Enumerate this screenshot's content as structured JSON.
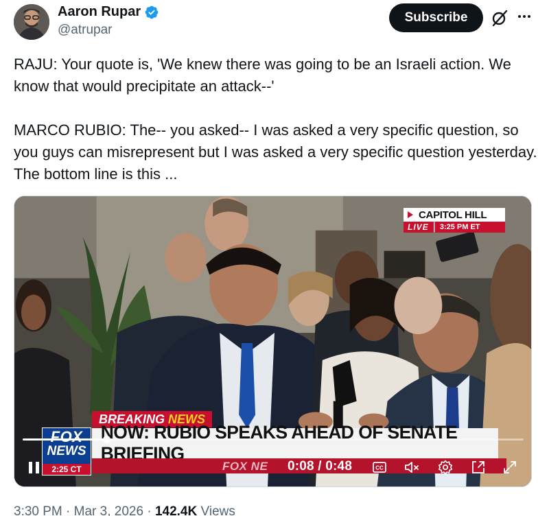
{
  "author": {
    "display_name": "Aaron Rupar",
    "handle": "@atrupar",
    "verified": true
  },
  "actions": {
    "subscribe_label": "Subscribe",
    "grok_icon": "grok-slash-icon",
    "more_icon": "more-horizontal-icon"
  },
  "tweet": {
    "paragraph_1": "RAJU: Your quote is, 'We knew there was going to be an Israeli action. We know that would precipitate an attack--'",
    "paragraph_2": "MARCO RUBIO: The-- you asked-- I was asked a very specific question, so you guys can misrepresent but I was asked a very specific question yesterday. The bottom line is this ..."
  },
  "video": {
    "location_banner": "CAPITOL HILL",
    "live_label": "LIVE",
    "live_time": "3:25 PM ET",
    "breaking_label_1": "BREAKING",
    "breaking_label_2": "NEWS",
    "headline": "NOW: RUBIO SPEAKS AHEAD OF SENATE BRIEFING",
    "brand_strip": "FOX NE",
    "logo_line_1": "FOX",
    "logo_line_2": "NEWS",
    "logo_time": "2:25 CT",
    "current_time": "0:08",
    "duration": "0:48",
    "time_display": "0:08 / 0:48",
    "progress_fraction": 0.167,
    "state": "playing",
    "icons": [
      "pause-icon",
      "captions-icon",
      "mute-icon",
      "settings-icon",
      "picture-in-picture-icon",
      "fullscreen-icon"
    ]
  },
  "meta": {
    "time": "3:30 PM",
    "date": "Mar 3, 2026",
    "views_count": "142.4K",
    "views_label": "Views"
  },
  "colors": {
    "verified_blue": "#1d9bf0",
    "fox_red": "#c8102e",
    "fox_blue": "#0b3d91",
    "breaking_yellow": "#ffd21f"
  }
}
